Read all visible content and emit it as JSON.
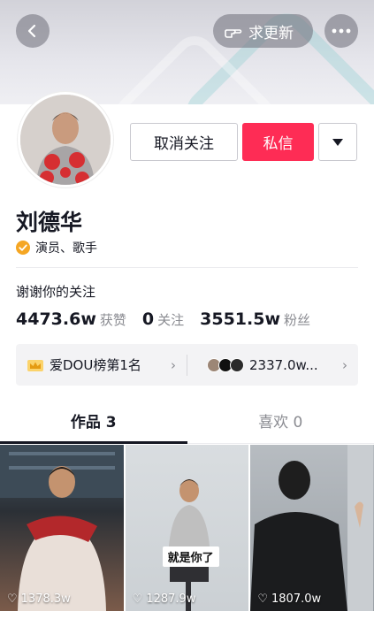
{
  "header": {
    "update_label": "求更新"
  },
  "profile": {
    "name": "刘德华",
    "verified_title": "演员、歌手",
    "bio": "谢谢你的关注",
    "unfollow_label": "取消关注",
    "message_label": "私信"
  },
  "stats": [
    {
      "value": "4473.6w",
      "label": "获赞"
    },
    {
      "value": "0",
      "label": "关注"
    },
    {
      "value": "3551.5w",
      "label": "粉丝"
    }
  ],
  "rank": {
    "left_label": "爱DOU榜第1名",
    "right_label": "2337.0w..."
  },
  "tabs": [
    {
      "label": "作品 3"
    },
    {
      "label": "喜欢 0"
    }
  ],
  "videos": [
    {
      "likes": "1378.3w"
    },
    {
      "likes": "1287.9w",
      "caption": "就是你了"
    },
    {
      "likes": "1807.0w"
    }
  ],
  "colors": {
    "accent": "#fe2c55",
    "verified": "#f5a623"
  }
}
